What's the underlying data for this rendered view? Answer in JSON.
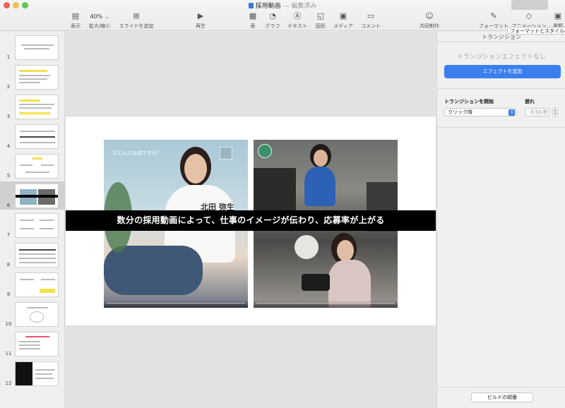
{
  "window": {
    "title": "採用動画",
    "separator": "—",
    "edited": "編集済み"
  },
  "toolbar": {
    "view_label": "表示",
    "zoom_value": "40%",
    "zoom_label": "拡大/縮小",
    "add_slide_label": "スライドを追加",
    "play_label": "再生",
    "table_label": "表",
    "chart_label": "グラフ",
    "text_label": "テキスト",
    "shape_label": "図形",
    "media_label": "メディア",
    "comment_label": "コメント",
    "collab_label": "共同制作",
    "format_label": "フォーマット",
    "animate_label": "アニメーション",
    "document_label": "書類",
    "tooltip": "フォーマットとスタイルの"
  },
  "slides": {
    "numbers": [
      "1",
      "2",
      "3",
      "4",
      "5",
      "6",
      "7",
      "8",
      "9",
      "10",
      "11",
      "12"
    ],
    "selected_index": 6
  },
  "slide": {
    "video1_tagline": "などんなお店ですか？",
    "video1_name": "北田 弥生",
    "caption": "数分の採用動画によって、仕事のイメージが伝わり、応募率が上がる"
  },
  "inspector": {
    "header": "トランジション",
    "no_effect": "トランジションエフェクトなし",
    "add_effect_button": "エフェクトを追加",
    "start_label": "トランジションを開始",
    "start_value": "クリック時",
    "delay_label": "遅れ",
    "delay_value": "0.50 秒",
    "build_order_button": "ビルドの順番"
  },
  "colors": {
    "accent": "#3a7ff0",
    "caption_bg": "#000000"
  }
}
